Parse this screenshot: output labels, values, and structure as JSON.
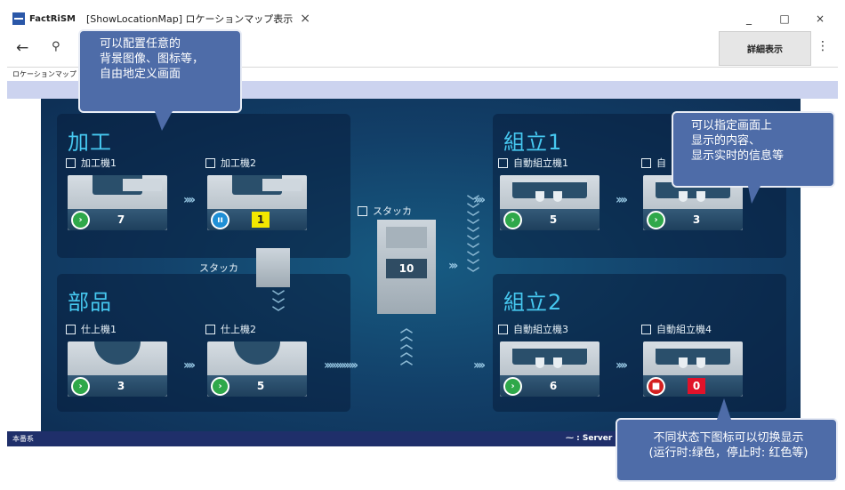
{
  "window": {
    "app_name": "FactRiSM",
    "title": "[ShowLocationMap] ロケーションマップ表示",
    "tab_close": "×",
    "minimize": "_",
    "maximize": "□",
    "close": "×"
  },
  "toolbar": {
    "back": "←",
    "key": "⚲",
    "detail_label": "詳細表示",
    "more": "⋮"
  },
  "breadcrumb": "ロケーションマップ",
  "map": {
    "panels": {
      "kakou": {
        "title": "加工"
      },
      "buhin": {
        "title": "部品"
      },
      "kumitate1": {
        "title": "組立1"
      },
      "kumitate2": {
        "title": "組立2"
      }
    },
    "machines": {
      "m1": {
        "label": "加工機1",
        "count": "7",
        "status": "run"
      },
      "m2": {
        "label": "加工機2",
        "count": "1",
        "status": "pause"
      },
      "m3": {
        "label": "仕上機1",
        "count": "3",
        "status": "run"
      },
      "m4": {
        "label": "仕上機2",
        "count": "5",
        "status": "run"
      },
      "m5": {
        "label": "自動組立機1",
        "count": "5",
        "status": "run"
      },
      "m6": {
        "label": "自",
        "count": "3",
        "status": "run"
      },
      "m7": {
        "label": "自動組立機3",
        "count": "6",
        "status": "run"
      },
      "m8": {
        "label": "自動組立機4",
        "count": "0",
        "status": "stop"
      }
    },
    "stacker_small_label": "スタッカ",
    "stacker_big_label": "スタッカ",
    "stacker_big_count": "10"
  },
  "statusbar": {
    "left": "本番系",
    "server": "⁓ : Server"
  },
  "callouts": {
    "c1": [
      "可以配置任意的",
      "背景图像、图标等，",
      "自由地定义画面"
    ],
    "c2": [
      "可以指定画面上",
      "显示的内容、",
      "显示实时的信息等"
    ],
    "c3": [
      "不同状态下图标可以切换显示",
      "(运行时:绿色，停止时: 红色等)"
    ]
  },
  "colors": {
    "run": "#2fa84a",
    "pause": "#1f8fd6",
    "stop": "#d42020",
    "warn_count": "#f2e800",
    "alarm_count": "#e1122a",
    "panel_title": "#46c8f0"
  }
}
